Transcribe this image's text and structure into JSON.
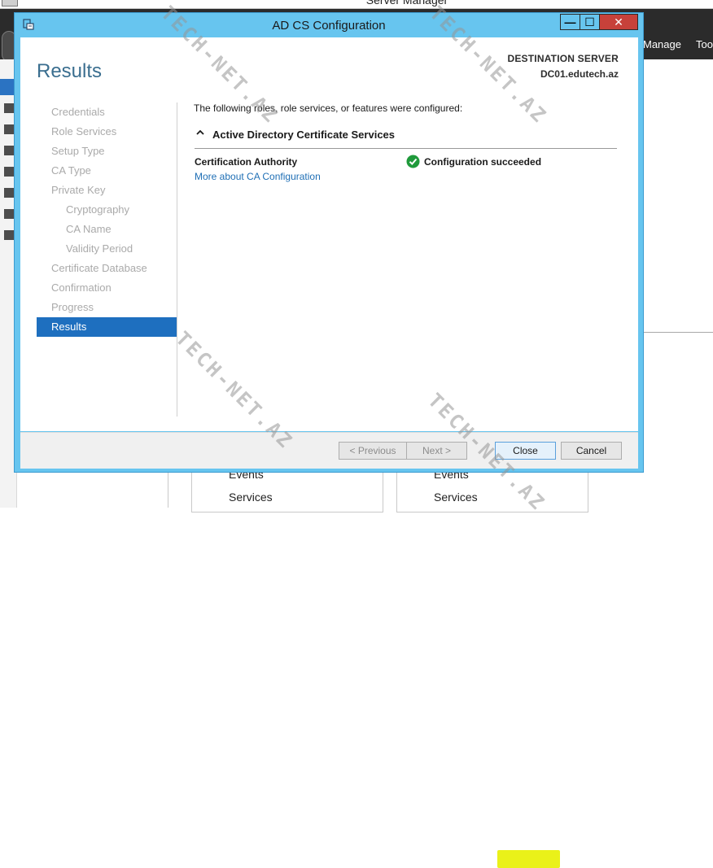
{
  "server_manager": {
    "title": "Server Manager",
    "menu": [
      "Manage",
      "Too"
    ],
    "panels": [
      {
        "items": [
          "Events",
          "Services"
        ]
      },
      {
        "items": [
          "Events",
          "Services"
        ]
      }
    ]
  },
  "dialog": {
    "title": "AD CS Configuration",
    "window_buttons": {
      "minimize": "—",
      "maximize": "☐",
      "close": "✕"
    },
    "heading": "Results",
    "destination_label": "DESTINATION SERVER",
    "destination_value": "DC01.edutech.az",
    "steps": [
      {
        "label": "Credentials",
        "level": 1,
        "active": false
      },
      {
        "label": "Role Services",
        "level": 1,
        "active": false
      },
      {
        "label": "Setup Type",
        "level": 1,
        "active": false
      },
      {
        "label": "CA Type",
        "level": 1,
        "active": false
      },
      {
        "label": "Private Key",
        "level": 1,
        "active": false
      },
      {
        "label": "Cryptography",
        "level": 2,
        "active": false
      },
      {
        "label": "CA Name",
        "level": 2,
        "active": false
      },
      {
        "label": "Validity Period",
        "level": 2,
        "active": false
      },
      {
        "label": "Certificate Database",
        "level": 1,
        "active": false
      },
      {
        "label": "Confirmation",
        "level": 1,
        "active": false
      },
      {
        "label": "Progress",
        "level": 1,
        "active": false
      },
      {
        "label": "Results",
        "level": 1,
        "active": true
      }
    ],
    "intro": "The following roles, role services, or features were configured:",
    "section_title": "Active Directory Certificate Services",
    "section_chevron": "^",
    "result": {
      "name": "Certification Authority",
      "link": "More about CA Configuration",
      "status": "Configuration succeeded"
    },
    "buttons": {
      "previous": "< Previous",
      "next": "Next >",
      "close": "Close",
      "cancel": "Cancel"
    },
    "colors": {
      "accent": "#1e6fbf",
      "titlebar": "#67c5ef",
      "success": "#1f9a3b",
      "highlight": "#e8f000"
    }
  },
  "watermark": "TECH-NET.AZ"
}
